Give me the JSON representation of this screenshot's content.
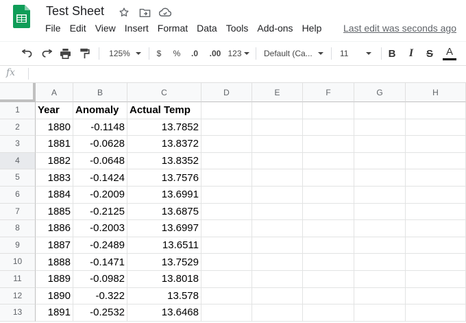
{
  "doc": {
    "title": "Test Sheet",
    "last_edit": "Last edit was seconds ago",
    "menu": [
      "File",
      "Edit",
      "View",
      "Insert",
      "Format",
      "Data",
      "Tools",
      "Add-ons",
      "Help"
    ]
  },
  "toolbar": {
    "zoom": "125%",
    "currency": "$",
    "percent": "%",
    "dec_decrease": ".0",
    "dec_increase": ".00",
    "more_formats": "123",
    "font": "Default (Ca...",
    "font_size": "11",
    "bold": "B",
    "italic": "I",
    "strike": "S",
    "text_color": "A"
  },
  "formula_bar": {
    "fx": "fx",
    "value": ""
  },
  "columns": [
    "A",
    "B",
    "C",
    "D",
    "E",
    "F",
    "G",
    "H"
  ],
  "rows": [
    {
      "n": "1",
      "a": "Year",
      "b": "Anomaly",
      "c": "Actual Temp"
    },
    {
      "n": "2",
      "a": "1880",
      "b": "-0.1148",
      "c": "13.7852"
    },
    {
      "n": "3",
      "a": "1881",
      "b": "-0.0628",
      "c": "13.8372"
    },
    {
      "n": "4",
      "a": "1882",
      "b": "-0.0648",
      "c": "13.8352"
    },
    {
      "n": "5",
      "a": "1883",
      "b": "-0.1424",
      "c": "13.7576"
    },
    {
      "n": "6",
      "a": "1884",
      "b": "-0.2009",
      "c": "13.6991"
    },
    {
      "n": "7",
      "a": "1885",
      "b": "-0.2125",
      "c": "13.6875"
    },
    {
      "n": "8",
      "a": "1886",
      "b": "-0.2003",
      "c": "13.6997"
    },
    {
      "n": "9",
      "a": "1887",
      "b": "-0.2489",
      "c": "13.6511"
    },
    {
      "n": "10",
      "a": "1888",
      "b": "-0.1471",
      "c": "13.7529"
    },
    {
      "n": "11",
      "a": "1889",
      "b": "-0.0982",
      "c": "13.8018"
    },
    {
      "n": "12",
      "a": "1890",
      "b": "-0.322",
      "c": "13.578"
    },
    {
      "n": "13",
      "a": "1891",
      "b": "-0.2532",
      "c": "13.6468"
    }
  ],
  "selected_row": "4",
  "colors": {
    "sheets_green": "#0F9D58",
    "header_bg": "#f8f9fa",
    "grid_line": "#e2e3e3"
  }
}
